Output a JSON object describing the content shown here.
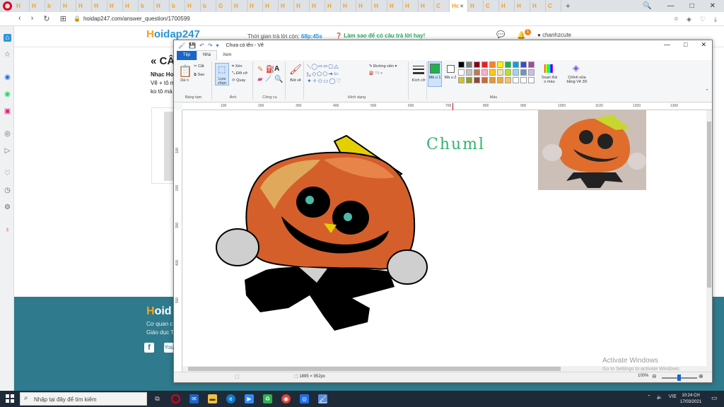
{
  "browser": {
    "tabs": [
      "H",
      "H",
      "b",
      "H",
      "H",
      "H",
      "H",
      "H",
      "b",
      "H",
      "b",
      "H",
      "b",
      "G",
      "H",
      "H",
      "H",
      "H",
      "H",
      "H",
      "H",
      "H",
      "H",
      "H",
      "H",
      "H",
      "H",
      "C",
      "H",
      "C",
      "H",
      "H",
      "H",
      "C"
    ],
    "active_tab": "Hc",
    "url": "hoidap247.com/answer_question/1700599",
    "window_controls": [
      "🔍",
      "—",
      "□",
      "✕"
    ]
  },
  "site": {
    "logo_h": "H",
    "logo_rest": "oidap247",
    "timer_label": "Thời gian trả lời còn:",
    "timer_value": "68p:45s",
    "howto": "Làm sao để có câu trả lời hay!",
    "bell_count": "1",
    "username": "chanhzcute",
    "page_title": "« CÂ",
    "text1": "Nhạc Ho",
    "text2": "Vẽ + tô m",
    "text3": "ko tô mà",
    "footer_logo_h": "H",
    "footer_logo_rest": "oid",
    "footer_t1": "Cơ quan c",
    "footer_t2": "Giáo dục T",
    "fb": "f",
    "yt": "You"
  },
  "paint": {
    "title": "Chưa có tên - Vẽ",
    "tabs": {
      "file": "Tệp",
      "home": "Nhà",
      "view": "Xem"
    },
    "groups": {
      "clipboard": "Bảng tạm",
      "image": "Ảnh",
      "tools": "Công cụ",
      "shapes": "Hình dạng",
      "colors": "Màu"
    },
    "buttons": {
      "paste": "Dá n",
      "cut": "Cắt",
      "copy": "Sao",
      "select": "Lựa chọn",
      "crop": "Xén",
      "resize": "Đổi cỡ",
      "rotate": "Quay",
      "brushes": "Bút vẽ",
      "outline": "Đường viền",
      "fill": "Tô",
      "size": "Kích cỡ",
      "color1": "Mà u 1",
      "color2": "Mà u 2",
      "edit_colors": "Soạn thả o màu",
      "paint3d": "Chỉnh sửa bằng Vẽ 3D"
    },
    "ruler": [
      "100",
      "200",
      "300",
      "400",
      "500",
      "600",
      "700",
      "800",
      "900",
      "1000",
      "1100",
      "1200",
      "1300"
    ],
    "ruler_v": [
      "100",
      "200",
      "300",
      "400",
      "500"
    ],
    "canvas_text": "Chuml",
    "dimensions": "1895 × 952px",
    "zoom": "100%",
    "colors": {
      "palette_row1": [
        "#000000",
        "#7f7f7f",
        "#880015",
        "#ed1c24",
        "#ff7f27",
        "#fff200",
        "#22b14c",
        "#00a2e8",
        "#3f48cc",
        "#a349a4"
      ],
      "palette_row2": [
        "#ffffff",
        "#c3c3c3",
        "#b97a57",
        "#ffaec9",
        "#ffc90e",
        "#efe4b0",
        "#b5e61d",
        "#99d9ea",
        "#7092be",
        "#c8bfe7"
      ],
      "palette_row3": [
        "#d2c12a",
        "#909f1e",
        "#8d4a3b",
        "#c66a3e",
        "#e19a3c",
        "#f0a940",
        "#f7c26b",
        "#ffffff",
        "#ffffff",
        "#ffffff"
      ],
      "color1": "#22b14c",
      "color2": "#ffffff"
    }
  },
  "watermark": {
    "line1": "Activate Windows",
    "line2": "Go to Settings to activate Windows."
  },
  "taskbar": {
    "search_placeholder": "Nhập tại đây để tìm kiếm",
    "lang": "VIE",
    "time": "10:24 CH",
    "date": "17/03/2021"
  }
}
